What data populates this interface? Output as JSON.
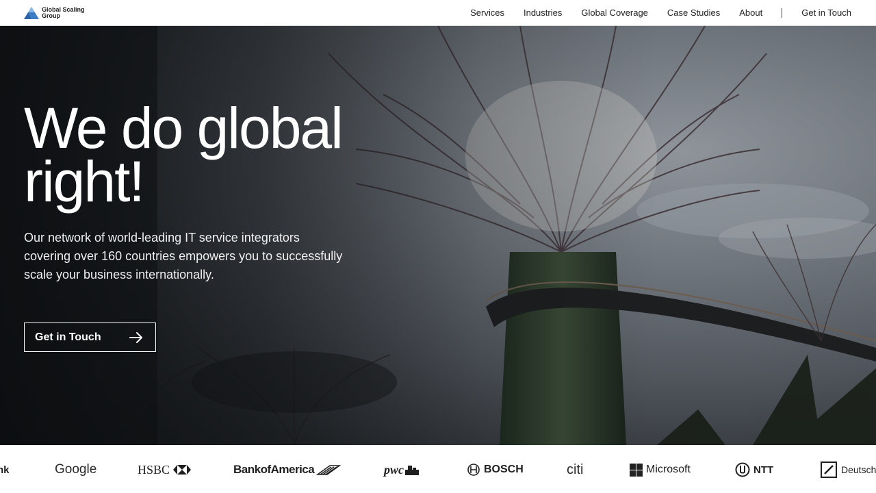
{
  "brand": {
    "name": "Global Scaling Group",
    "logo_icon": "triangle-mountain-icon",
    "colors": {
      "accent_blue": "#3c7dc4",
      "accent_light": "#8ab8e6"
    }
  },
  "nav": {
    "items": [
      {
        "label": "Services"
      },
      {
        "label": "Industries"
      },
      {
        "label": "Global Coverage"
      },
      {
        "label": "Case Studies"
      },
      {
        "label": "About"
      }
    ],
    "cta": "Get in Touch"
  },
  "hero": {
    "title": "We do global right!",
    "subtitle": "Our network of world-leading IT service integrators covering over 160 countries empowers you to successfully scale your business internationally.",
    "button_label": "Get in Touch",
    "button_icon": "arrow-right-icon",
    "background": "photo of Supertree Grove towers with elevated walkway"
  },
  "clients": {
    "logos": [
      {
        "name": "bank-partial",
        "text": "nk"
      },
      {
        "name": "google",
        "text": "Google"
      },
      {
        "name": "hsbc",
        "text": "HSBC"
      },
      {
        "name": "bank-of-america",
        "text": "BankofAmerica"
      },
      {
        "name": "pwc",
        "text": "pwc"
      },
      {
        "name": "bosch",
        "text": "BOSCH"
      },
      {
        "name": "citi",
        "text": "citi"
      },
      {
        "name": "microsoft",
        "text": "Microsoft"
      },
      {
        "name": "ntt",
        "text": "NTT"
      },
      {
        "name": "deutsche-bank",
        "text": "Deutsche"
      }
    ]
  }
}
